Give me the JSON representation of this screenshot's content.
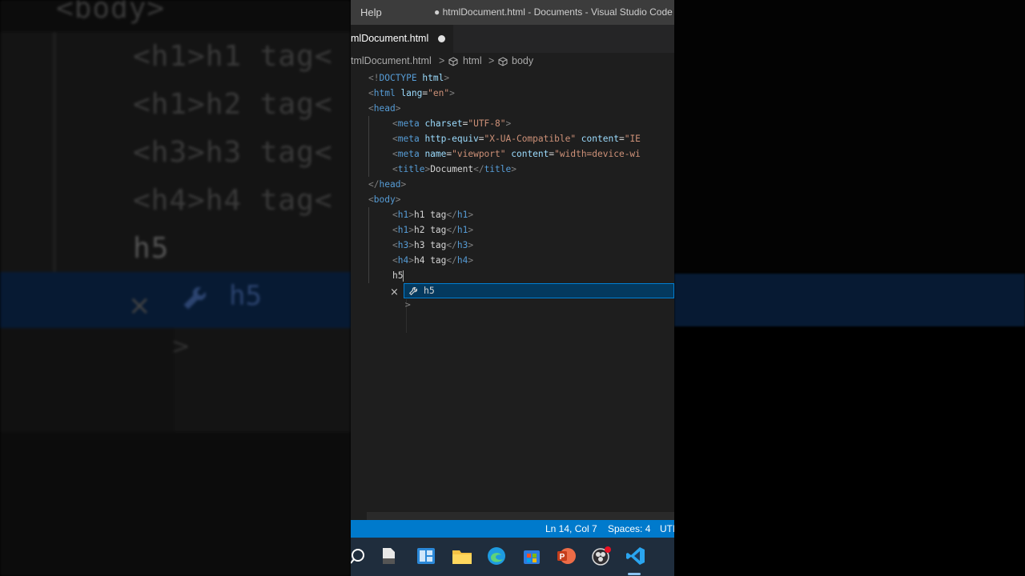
{
  "window": {
    "menu_label": "Help",
    "title": "● htmlDocument.html - Documents - Visual Studio Code"
  },
  "tab": {
    "label": "mlDocument.html"
  },
  "breadcrumb": {
    "file": "tmlDocument.html",
    "sep": ">",
    "html": "html",
    "body": "body"
  },
  "code": {
    "l1": {
      "open": "<!",
      "doctype": "DOCTYPE",
      "html": " html",
      "close": ">"
    },
    "l2": {
      "open": "<",
      "tag": "html",
      "attr": " lang",
      "eq": "=",
      "val": "\"en\"",
      "close": ">"
    },
    "l3": {
      "open": "<",
      "tag": "head",
      "close": ">"
    },
    "l4": {
      "open": "<",
      "tag": "meta",
      "attr": " charset",
      "eq": "=",
      "val": "\"UTF-8\"",
      "close": ">"
    },
    "l5": {
      "open": "<",
      "tag": "meta",
      "attr": " http-equiv",
      "eq": "=",
      "val": "\"X-UA-Compatible\"",
      "attr2": " content",
      "eq2": "=",
      "val2": "\"IE"
    },
    "l6": {
      "open": "<",
      "tag": "meta",
      "attr": " name",
      "eq": "=",
      "val": "\"viewport\"",
      "attr2": " content",
      "eq2": "=",
      "val2": "\"width=device-wi"
    },
    "l7": {
      "open": "<",
      "tag": "title",
      "close": ">",
      "text": "Document",
      "open2": "</",
      "tag2": "title",
      "close2": ">"
    },
    "l8": {
      "open": "</",
      "tag": "head",
      "close": ">"
    },
    "l9": {
      "open": "<",
      "tag": "body",
      "close": ">"
    },
    "l10": {
      "open": "<",
      "tag": "h1",
      "close": ">",
      "text": "h1 tag",
      "open2": "</",
      "tag2": "h1",
      "close2": ">"
    },
    "l11": {
      "open": "<",
      "tag": "h1",
      "close": ">",
      "text": "h2 tag",
      "open2": "</",
      "tag2": "h1",
      "close2": ">"
    },
    "l12": {
      "open": "<",
      "tag": "h3",
      "close": ">",
      "text": "h3 tag",
      "open2": "</",
      "tag2": "h3",
      "close2": ">"
    },
    "l13": {
      "open": "<",
      "tag": "h4",
      "close": ">",
      "text": "h4 tag",
      "open2": "</",
      "tag2": "h4",
      "close2": ">"
    },
    "l14": {
      "text": "h5"
    }
  },
  "suggest": {
    "label": "h5",
    "close": "×",
    "more": ">"
  },
  "status": {
    "position": "Ln 14, Col 7",
    "spaces": "Spaces: 4",
    "encoding": "UTI"
  },
  "background_zoom": {
    "body": "<body>",
    "lines": [
      "<h1>h1 tag<",
      "<h1>h2 tag<",
      "<h3>h3 tag<",
      "<h4>h4 tag<"
    ],
    "typed": "h5",
    "suggest": "h5",
    "close": "×",
    "more": ">"
  },
  "taskbar": {
    "icons": [
      "search-icon",
      "file-icon",
      "widgets-icon",
      "file-explorer-icon",
      "edge-icon",
      "store-icon",
      "powerpoint-icon",
      "obs-icon",
      "vscode-icon"
    ]
  },
  "colors": {
    "editor_bg": "#1e1e1e",
    "tag": "#569cd6",
    "attr": "#9cdcfe",
    "string": "#ce9178",
    "status_bar": "#007acc",
    "suggest_bg": "#04395e"
  }
}
